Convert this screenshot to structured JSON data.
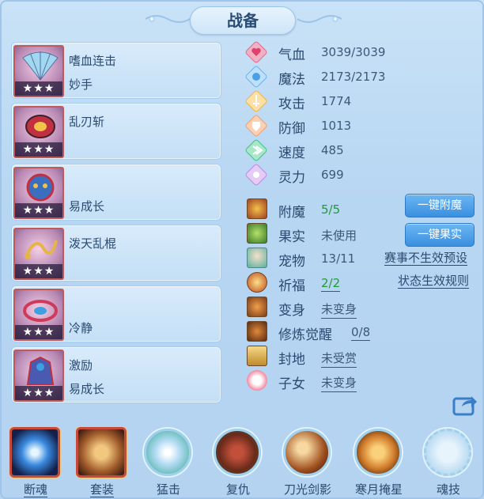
{
  "title": "战备",
  "cards": [
    {
      "name": "嗜血连击",
      "sub": "妙手",
      "stars": "★★★"
    },
    {
      "name": "乱刃斩",
      "sub": "",
      "stars": "★★★"
    },
    {
      "name": "",
      "sub": "易成长",
      "stars": "★★★"
    },
    {
      "name": "泼天乱棍",
      "sub": "",
      "stars": "★★★"
    },
    {
      "name": "",
      "sub": "冷静",
      "stars": "★★★"
    },
    {
      "name": "激励",
      "sub": "易成长",
      "stars": "★★★"
    }
  ],
  "stats": [
    {
      "label": "气血",
      "value": "3039/3039",
      "icon": "heart-icon",
      "color": "#e66a8a"
    },
    {
      "label": "魔法",
      "value": "2173/2173",
      "icon": "mana-icon",
      "color": "#6ab3ef"
    },
    {
      "label": "攻击",
      "value": "1774",
      "icon": "sword-icon",
      "color": "#f2b544"
    },
    {
      "label": "防御",
      "value": "1013",
      "icon": "shield-icon",
      "color": "#f2a068"
    },
    {
      "label": "速度",
      "value": "485",
      "icon": "speed-icon",
      "color": "#3ec48a"
    },
    {
      "label": "灵力",
      "value": "699",
      "icon": "spirit-icon",
      "color": "#c08ae6"
    }
  ],
  "extras": [
    {
      "label": "附魔",
      "value": "5/5",
      "icon": "enchant-icon",
      "green": true,
      "underline": false
    },
    {
      "label": "果实",
      "value": "未使用",
      "icon": "fruit-icon",
      "green": false,
      "underline": false
    },
    {
      "label": "宠物",
      "value": "13/11",
      "icon": "pet-icon",
      "green": false,
      "underline": false
    },
    {
      "label": "祈福",
      "value": "2/2",
      "icon": "blessing-icon",
      "green": true,
      "underline": true
    },
    {
      "label": "变身",
      "value": "未变身",
      "icon": "transform-icon",
      "green": false,
      "underline": true
    },
    {
      "label": "修炼觉醒",
      "value": "0/8",
      "icon": "cultivation-icon",
      "green": false,
      "underline": true
    },
    {
      "label": "封地",
      "value": "未受赏",
      "icon": "fief-icon",
      "green": false,
      "underline": true
    },
    {
      "label": "子女",
      "value": "未变身",
      "icon": "child-icon",
      "green": false,
      "underline": true
    }
  ],
  "buttons": {
    "enchant": "一键附魔",
    "fruit": "一键果实"
  },
  "links": {
    "tournament_preset": "赛事不生效预设",
    "status_rules": "状态生效规则"
  },
  "skills": [
    {
      "label": "断魂",
      "style": "square",
      "underline": true
    },
    {
      "label": "套装",
      "style": "square",
      "underline": true
    },
    {
      "label": "猛击",
      "style": "circle",
      "underline": false
    },
    {
      "label": "复仇",
      "style": "circle",
      "underline": false
    },
    {
      "label": "刀光剑影",
      "style": "circle",
      "underline": false
    },
    {
      "label": "寒月掩星",
      "style": "circle",
      "underline": false
    },
    {
      "label": "魂技",
      "style": "circle",
      "underline": false
    }
  ]
}
